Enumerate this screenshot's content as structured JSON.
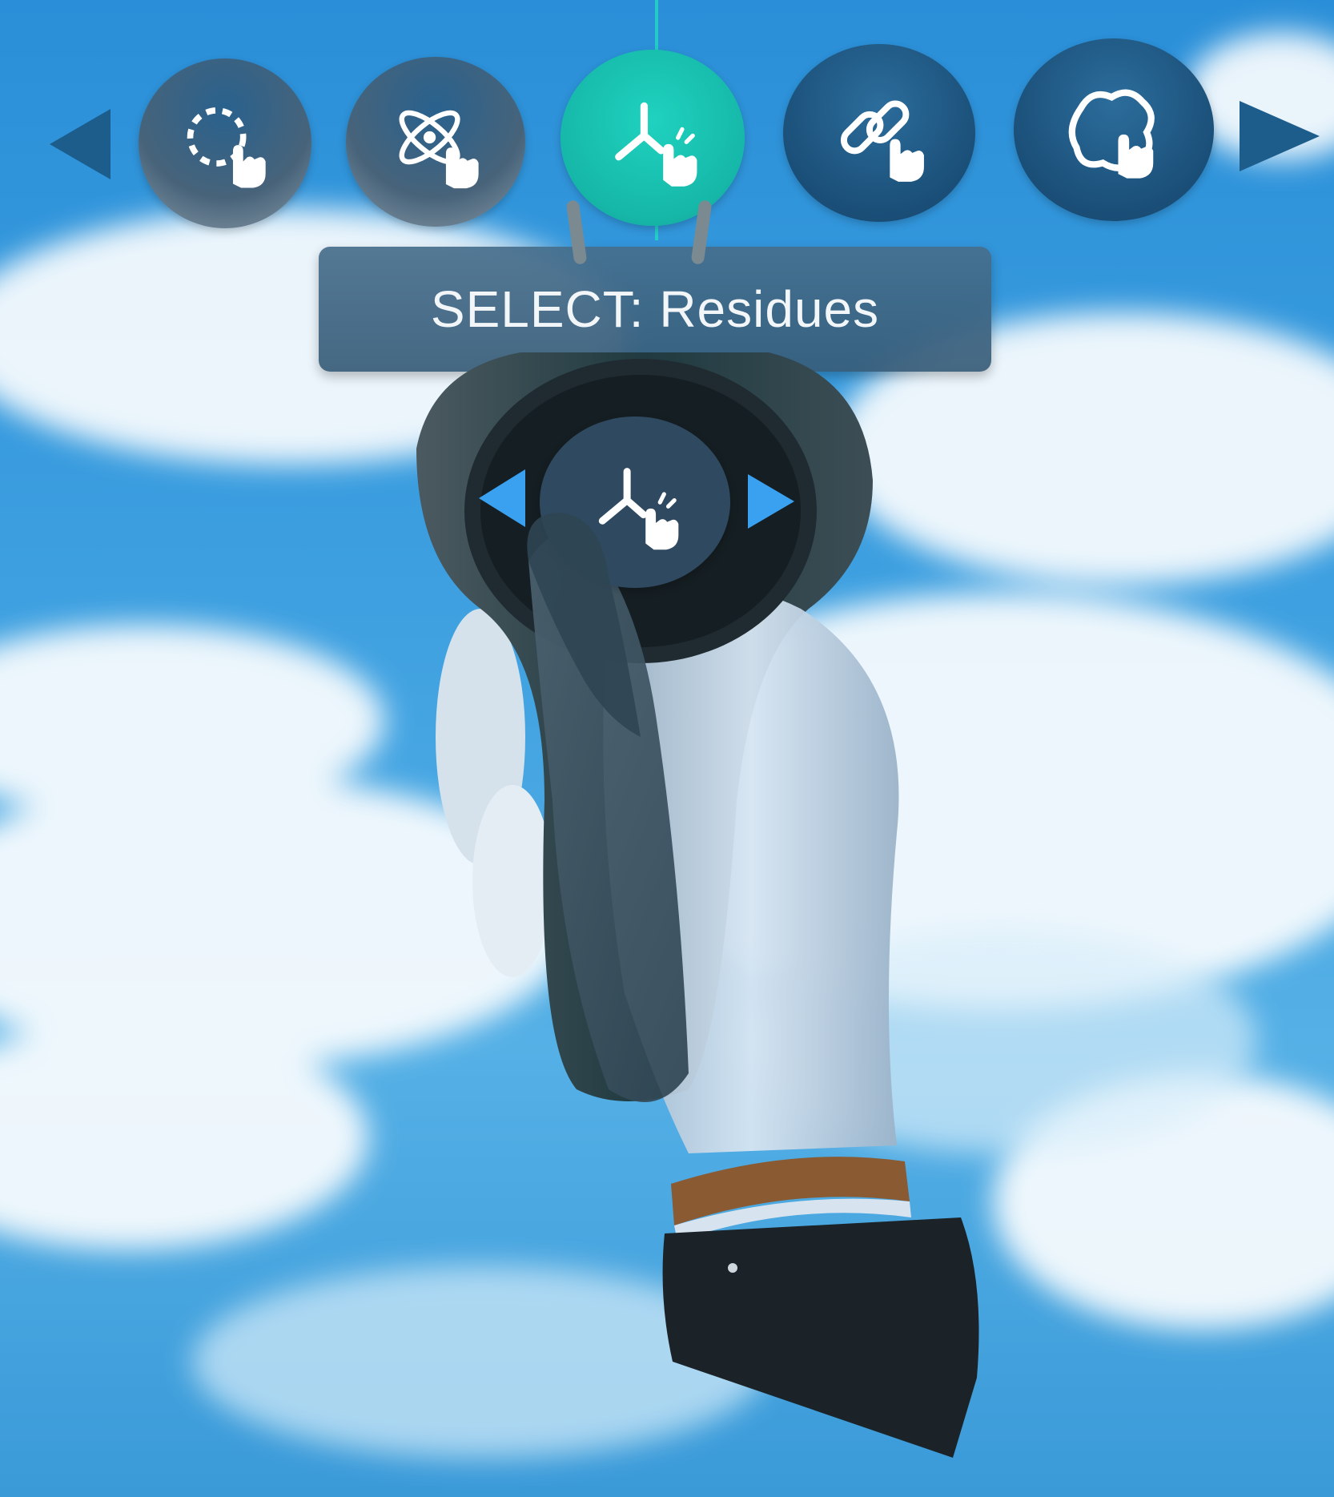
{
  "tooltip": {
    "text": "SELECT: Residues"
  },
  "menu": {
    "tools": [
      {
        "icon": "lasso-select-icon",
        "state": "dim"
      },
      {
        "icon": "atom-select-icon",
        "state": "dim"
      },
      {
        "icon": "residue-select-icon",
        "state": "active"
      },
      {
        "icon": "bond-select-icon",
        "state": "normal"
      },
      {
        "icon": "surface-select-icon",
        "state": "normal"
      }
    ],
    "nav_left_icon": "triangle-left-icon",
    "nav_right_icon": "triangle-right-icon"
  },
  "controller": {
    "current_tool_icon": "residue-select-icon",
    "prev_icon": "triangle-left-icon",
    "next_icon": "triangle-right-icon"
  },
  "colors": {
    "sky": "#2a8fd8",
    "accent": "#1fd2bf",
    "button": "#1a4f78",
    "arrow": "#3aa0f0"
  }
}
